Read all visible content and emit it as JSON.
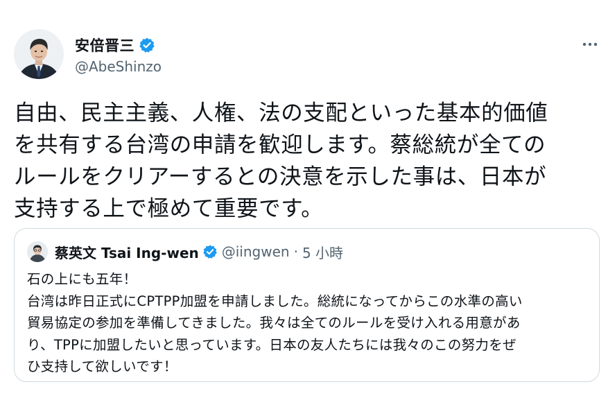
{
  "author": {
    "display_name": "安倍晋三",
    "handle": "@AbeShinzo",
    "verified": true
  },
  "tweet": {
    "text": "自由、民主主義、人権、法の支配といった基本的価値\nを共有する台湾の申請を歓迎します。蔡総統が全ての\nルールをクリアーするとの決意を示した事は、日本が\n支持する上で極めて重要です。"
  },
  "quoted": {
    "display_name": "蔡英文 Tsai Ing-wen",
    "handle": "@iingwen",
    "separator": "·",
    "time": "5 小時",
    "verified": true,
    "text": "石の上にも五年！\n台湾は昨日正式にCPTPP加盟を申請しました。総統になってからこの水準の高い\n貿易協定の参加を準備してきました。我々は全てのルールを受け入れる用意があ\nり、TPPに加盟したいと思っています。日本の友人たちには我々のこの努力をぜ\nひ支持して欲しいです！"
  },
  "icons": {
    "verified": "verified-badge-icon",
    "more": "more-options-icon"
  },
  "colors": {
    "verified_blue": "#1d9bf0",
    "secondary_text": "#536471",
    "border": "#cfd9de"
  }
}
